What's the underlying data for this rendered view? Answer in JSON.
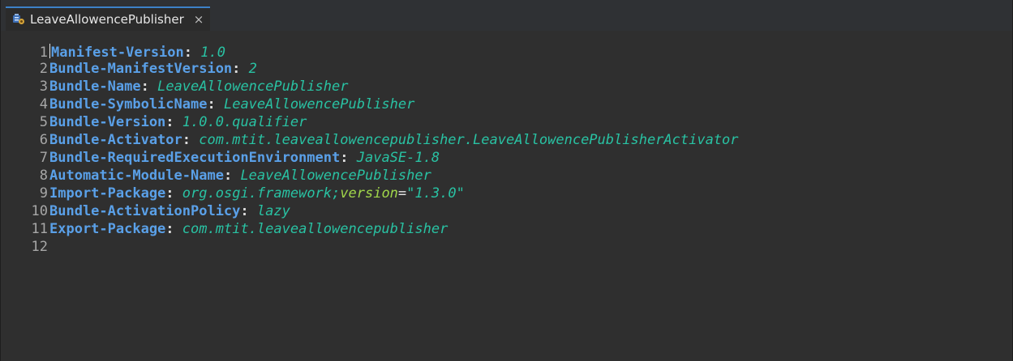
{
  "tab": {
    "title": "LeaveAllowencePublisher",
    "close": "×",
    "icon": "manifest-file-icon"
  },
  "colors": {
    "key": "#5aa0e8",
    "value": "#29c2a3",
    "attribute": "#a0d64a",
    "line_number": "#a7a7a7",
    "background": "#2f2f2f"
  },
  "lines": [
    {
      "num": "1",
      "key": "Manifest-Version",
      "value": "1.0"
    },
    {
      "num": "2",
      "key": "Bundle-ManifestVersion",
      "value": "2"
    },
    {
      "num": "3",
      "key": "Bundle-Name",
      "value": "LeaveAllowencePublisher"
    },
    {
      "num": "4",
      "key": "Bundle-SymbolicName",
      "value": "LeaveAllowencePublisher"
    },
    {
      "num": "5",
      "key": "Bundle-Version",
      "value": "1.0.0.qualifier"
    },
    {
      "num": "6",
      "key": "Bundle-Activator",
      "value": "com.mtit.leaveallowencepublisher.LeaveAllowencePublisherActivator"
    },
    {
      "num": "7",
      "key": "Bundle-RequiredExecutionEnvironment",
      "value": "JavaSE-1.8"
    },
    {
      "num": "8",
      "key": "Automatic-Module-Name",
      "value": "LeaveAllowencePublisher"
    },
    {
      "num": "9",
      "key": "Import-Package",
      "value": "org.osgi.framework;",
      "attr": "version",
      "eq": "=",
      "attr_value": "\"1.3.0\""
    },
    {
      "num": "10",
      "key": "Bundle-ActivationPolicy",
      "value": "lazy"
    },
    {
      "num": "11",
      "key": "Export-Package",
      "value": "com.mtit.leaveallowencepublisher"
    },
    {
      "num": "12"
    }
  ],
  "colon": ":"
}
